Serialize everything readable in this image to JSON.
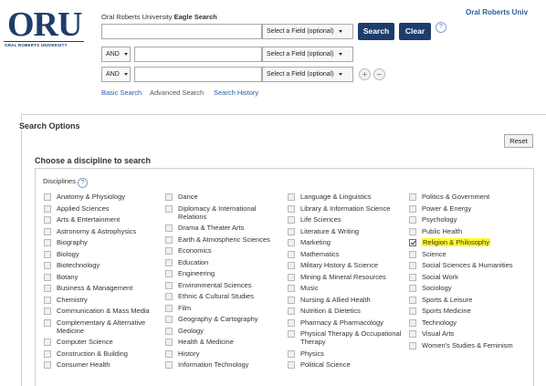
{
  "header": {
    "logo_text": "ORU",
    "logo_subtitle": "ORAL ROBERTS UNIVERSITY",
    "top_link": "Oral Roberts Univ",
    "search_title_prefix": "Oral Roberts University ",
    "search_title_brand": "Eagle Search"
  },
  "search": {
    "rows": [
      {
        "bool": "",
        "field": "Select a Field (optional)"
      },
      {
        "bool": "AND",
        "field": "Select a Field (optional)"
      },
      {
        "bool": "AND",
        "field": "Select a Field (optional)"
      }
    ],
    "search_button": "Search",
    "clear_button": "Clear",
    "help_icon": "?",
    "modes": [
      "Basic Search",
      "Advanced Search",
      "Search History"
    ]
  },
  "options": {
    "title": "Search Options",
    "reset_label": "Reset",
    "discipline_section_title": "Choose a discipline to search",
    "disciplines_label": "Disciplines",
    "columns": [
      [
        {
          "label": "Anatomy & Physiology",
          "checked": false
        },
        {
          "label": "Applied Sciences",
          "checked": false
        },
        {
          "label": "Arts & Entertainment",
          "checked": false
        },
        {
          "label": "Astronomy & Astrophysics",
          "checked": false
        },
        {
          "label": "Biography",
          "checked": false
        },
        {
          "label": "Biology",
          "checked": false
        },
        {
          "label": "Biotechnology",
          "checked": false
        },
        {
          "label": "Botany",
          "checked": false
        },
        {
          "label": "Business & Management",
          "checked": false
        },
        {
          "label": "Chemistry",
          "checked": false
        },
        {
          "label": "Communication & Mass Media",
          "checked": false
        },
        {
          "label": "Complementary & Alternative",
          "label2": "Medicine",
          "checked": false
        },
        {
          "label": "Computer Science",
          "checked": false
        },
        {
          "label": "Construction & Building",
          "checked": false
        },
        {
          "label": "Consumer Health",
          "checked": false
        }
      ],
      [
        {
          "label": "Dance",
          "checked": false
        },
        {
          "label": "Diplomacy & International",
          "label2": "Relations",
          "checked": false
        },
        {
          "label": "Drama & Theater Arts",
          "checked": false
        },
        {
          "label": "Earth & Atmospheric Sciences",
          "checked": false
        },
        {
          "label": "Economics",
          "checked": false
        },
        {
          "label": "Education",
          "checked": false
        },
        {
          "label": "Engineering",
          "checked": false
        },
        {
          "label": "Environmental Sciences",
          "checked": false
        },
        {
          "label": "Ethnic & Cultural Studies",
          "checked": false
        },
        {
          "label": "Film",
          "checked": false
        },
        {
          "label": "Geography & Cartography",
          "checked": false
        },
        {
          "label": "Geology",
          "checked": false
        },
        {
          "label": "Health & Medicine",
          "checked": false
        },
        {
          "label": "History",
          "checked": false
        },
        {
          "label": "Information Technology",
          "checked": false
        }
      ],
      [
        {
          "label": "Language & Linguistics",
          "checked": false
        },
        {
          "label": "Library & Information Science",
          "checked": false
        },
        {
          "label": "Life Sciences",
          "checked": false
        },
        {
          "label": "Literature & Writing",
          "checked": false
        },
        {
          "label": "Marketing",
          "checked": false
        },
        {
          "label": "Mathematics",
          "checked": false
        },
        {
          "label": "Military History & Science",
          "checked": false
        },
        {
          "label": "Mining & Mineral Resources",
          "checked": false
        },
        {
          "label": "Music",
          "checked": false
        },
        {
          "label": "Nursing & Allied Health",
          "checked": false
        },
        {
          "label": "Nutrition & Dietetics",
          "checked": false
        },
        {
          "label": "Pharmacy & Pharmacology",
          "checked": false
        },
        {
          "label": "Physical Therapy & Occupational",
          "label2": "Therapy",
          "checked": false
        },
        {
          "label": "Physics",
          "checked": false
        },
        {
          "label": "Political Science",
          "checked": false
        }
      ],
      [
        {
          "label": "Politics & Government",
          "checked": false
        },
        {
          "label": "Power & Energy",
          "checked": false
        },
        {
          "label": "Psychology",
          "checked": false
        },
        {
          "label": "Public Health",
          "checked": false
        },
        {
          "label": "Religion & Philosophy",
          "checked": true,
          "highlight": "#fffa2a"
        },
        {
          "label": "Science",
          "checked": false
        },
        {
          "label": "Social Sciences & Humanities",
          "checked": false
        },
        {
          "label": "Social Work",
          "checked": false
        },
        {
          "label": "Sociology",
          "checked": false
        },
        {
          "label": "Sports & Leisure",
          "checked": false
        },
        {
          "label": "Sports Medicine",
          "checked": false
        },
        {
          "label": "Technology",
          "checked": false
        },
        {
          "label": "Visual Arts",
          "checked": false
        },
        {
          "label": "Women's Studies & Feminism",
          "checked": false
        }
      ]
    ]
  },
  "colors": {
    "brand": "#1f3c6b",
    "link": "#2a5d9f",
    "highlight": "#fffa2a"
  }
}
